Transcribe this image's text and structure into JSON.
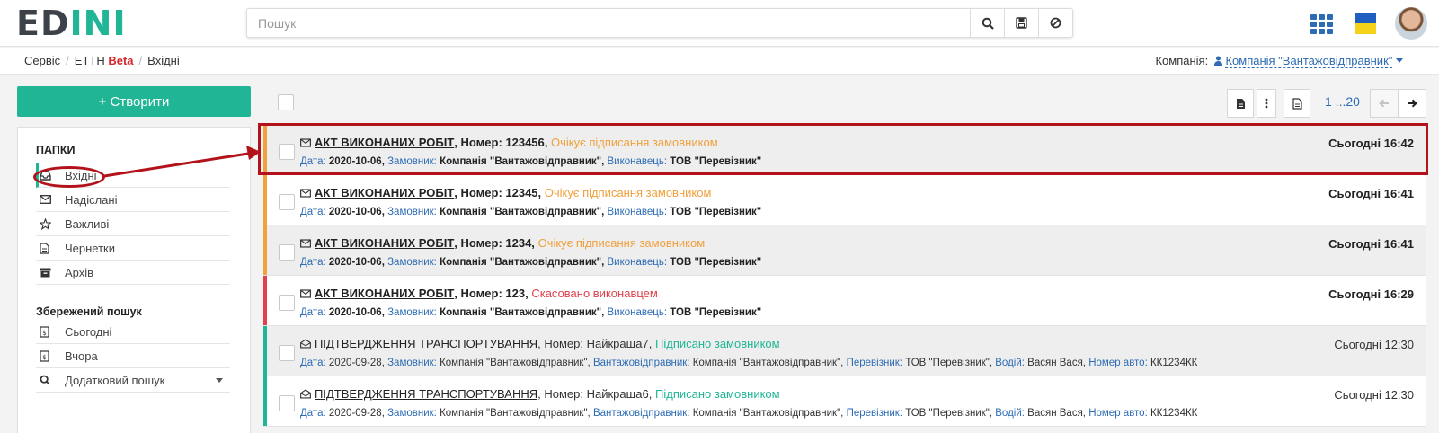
{
  "header": {
    "logo": {
      "part1": "ED",
      "part2": "I",
      "part3": "N",
      "part4": "I"
    },
    "search": {
      "placeholder": "Пошук",
      "value": ""
    },
    "search_icon": "search-icon",
    "save_icon": "floppy-icon",
    "clear_icon": "block-icon"
  },
  "breadcrumb": {
    "items": [
      "Сервіс",
      "ЕТТН",
      "Вхідні"
    ],
    "beta": "Beta"
  },
  "company": {
    "label": "Компанія:",
    "value": "Компанія \"Вантажовідправник\""
  },
  "sidebar": {
    "create_label": "+ Створити",
    "folders_title": "ПАПКИ",
    "folders": [
      {
        "label": "Вхідні",
        "icon": "inbox-icon"
      },
      {
        "label": "Надіслані",
        "icon": "envelope-icon"
      },
      {
        "label": "Важливі",
        "icon": "star-icon"
      },
      {
        "label": "Чернетки",
        "icon": "file-icon"
      },
      {
        "label": "Архів",
        "icon": "archive-icon"
      }
    ],
    "saved_title": "Збережений пошук",
    "saved": [
      {
        "label": "Сьогодні",
        "icon": "calendar-icon"
      },
      {
        "label": "Вчора",
        "icon": "calendar-icon"
      },
      {
        "label": "Додатковий пошук",
        "icon": "search-icon"
      }
    ]
  },
  "toolbar": {
    "pager": "1 ...20"
  },
  "labels": {
    "date": "Дата:",
    "customer": "Замовник:",
    "executor": "Виконавець:",
    "shipper": "Вантажовідправник:",
    "carrier": "Перевізник:",
    "driver": "Водій:",
    "vehicle": "Номер авто:"
  },
  "documents": [
    {
      "doc": "АКТ ВИКОНАНИХ РОБІТ",
      "number": ", Номер: 123456,",
      "status": "Очікує підписання замовником",
      "status_color": "#f0a03c",
      "time": "Сьогодні 16:42",
      "date": "2020-10-06,",
      "customer": "Компанія \"Вантажовідправник\",",
      "executor": "ТОВ \"Перевізник\""
    },
    {
      "doc": "АКТ ВИКОНАНИХ РОБІТ",
      "number": ", Номер: 12345,",
      "status": "Очікує підписання замовником",
      "status_color": "#f0a03c",
      "time": "Сьогодні 16:41",
      "date": "2020-10-06,",
      "customer": "Компанія \"Вантажовідправник\",",
      "executor": "ТОВ \"Перевізник\""
    },
    {
      "doc": "АКТ ВИКОНАНИХ РОБІТ",
      "number": ", Номер: 1234,",
      "status": "Очікує підписання замовником",
      "status_color": "#f0a03c",
      "time": "Сьогодні 16:41",
      "date": "2020-10-06,",
      "customer": "Компанія \"Вантажовідправник\",",
      "executor": "ТОВ \"Перевізник\""
    },
    {
      "doc": "АКТ ВИКОНАНИХ РОБІТ",
      "number": ", Номер: 123,",
      "status": "Скасовано виконавцем",
      "status_color": "#e0404b",
      "time": "Сьогодні 16:29",
      "date": "2020-10-06,",
      "customer": "Компанія \"Вантажовідправник\",",
      "executor": "ТОВ \"Перевізник\""
    },
    {
      "doc": "ПІДТВЕРДЖЕННЯ ТРАНСПОРТУВАННЯ",
      "number": ", Номер: Найкраща7,",
      "status": "Підписано замовником",
      "status_color": "#1fb595",
      "time": "Сьогодні 12:30",
      "date": "2020-09-28,",
      "customer": "Компанія \"Вантажовідправник\",",
      "shipper": "Компанія \"Вантажовідправник\",",
      "carrier": "ТОВ \"Перевізник\",",
      "driver": "Васян Вася,",
      "vehicle": "КК1234КК"
    },
    {
      "doc": "ПІДТВЕРДЖЕННЯ ТРАНСПОРТУВАННЯ",
      "number": ", Номер: Найкраща6,",
      "status": "Підписано замовником",
      "status_color": "#1fb595",
      "time": "Сьогодні 12:30",
      "date": "2020-09-28,",
      "customer": "Компанія \"Вантажовідправник\",",
      "shipper": "Компанія \"Вантажовідправник\",",
      "carrier": "ТОВ \"Перевізник\",",
      "driver": "Васян Вася,",
      "vehicle": "КК1234КК"
    }
  ],
  "colors": {
    "accent": "#1fb595",
    "link": "#2d6bb4",
    "annotation": "#b3121b",
    "pending": "#f0a03c",
    "cancelled": "#e0404b"
  }
}
